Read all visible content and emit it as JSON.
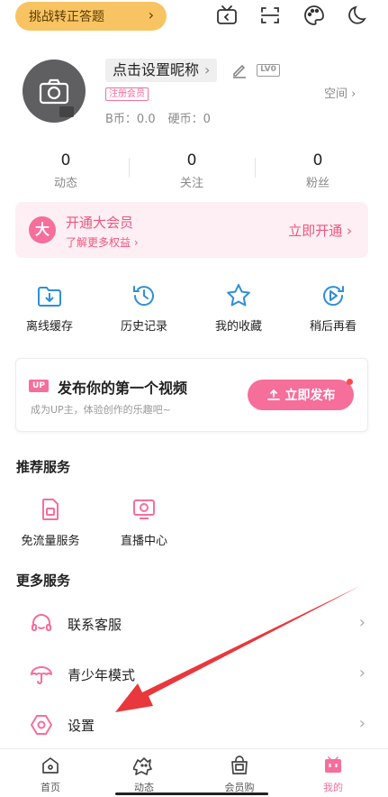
{
  "topbar": {
    "challenge_label": "挑战转正答题",
    "icons": [
      "tv-scan-icon",
      "scan-icon",
      "palette-icon",
      "moon-icon"
    ]
  },
  "profile": {
    "nickname": "点击设置昵称",
    "level": "LV0",
    "member_tag": "注册会员",
    "b_coin": "B币：0.0",
    "hard_coin": "硬币：0",
    "space_label": "空间"
  },
  "stats": [
    {
      "value": "0",
      "label": "动态"
    },
    {
      "value": "0",
      "label": "关注"
    },
    {
      "value": "0",
      "label": "粉丝"
    }
  ],
  "vip": {
    "logo": "大",
    "title": "开通大会员",
    "subtitle": "了解更多权益",
    "cta": "立即开通"
  },
  "quick_actions": [
    {
      "label": "离线缓存",
      "icon": "download-folder-icon"
    },
    {
      "label": "历史记录",
      "icon": "history-clock-icon"
    },
    {
      "label": "我的收藏",
      "icon": "star-icon"
    },
    {
      "label": "稍后再看",
      "icon": "watch-later-icon"
    }
  ],
  "upload": {
    "tag": "UP",
    "title": "发布你的第一个视频",
    "subtitle": "成为UP主，体验创作的乐趣吧~",
    "button": "立即发布"
  },
  "recommended": {
    "title": "推荐服务",
    "items": [
      {
        "label": "免流量服务",
        "icon": "sim-card-icon"
      },
      {
        "label": "直播中心",
        "icon": "live-tv-icon"
      }
    ]
  },
  "more": {
    "title": "更多服务",
    "items": [
      {
        "label": "联系客服",
        "icon": "headset-icon"
      },
      {
        "label": "青少年模式",
        "icon": "umbrella-icon"
      },
      {
        "label": "设置",
        "icon": "settings-icon"
      }
    ]
  },
  "bottom_nav": [
    {
      "label": "首页",
      "icon": "home-icon",
      "active": false
    },
    {
      "label": "动态",
      "icon": "dynamic-icon",
      "active": false
    },
    {
      "label": "会员购",
      "icon": "shopping-bag-icon",
      "active": false
    },
    {
      "label": "我的",
      "icon": "tv-mine-icon",
      "active": true
    }
  ],
  "colors": {
    "accent": "#f56f9a",
    "challenge_bg": "#f8c463",
    "vip_bg": "#fdeff3",
    "annotation_arrow": "#e8383d"
  }
}
